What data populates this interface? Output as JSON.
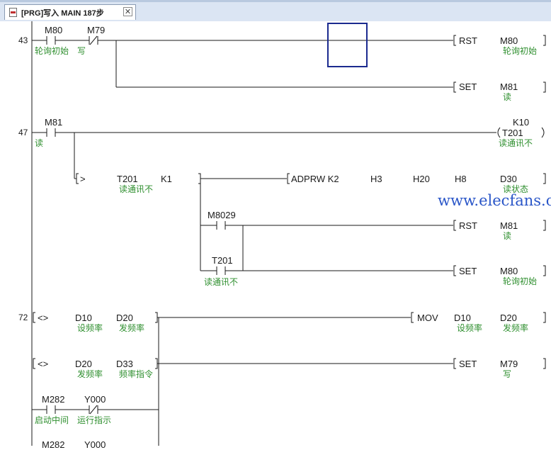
{
  "tab": {
    "title": "[PRG]写入 MAIN 187步",
    "close_glyph": "✕"
  },
  "watermark": "www.elecfans.com",
  "rungs": {
    "r43": {
      "step": "43",
      "contacts": [
        {
          "device": "M80",
          "comment": "轮询初始"
        },
        {
          "device": "M79",
          "comment": "写"
        }
      ],
      "out1": {
        "instr": "RST",
        "device": "M80",
        "comment": "轮询初始"
      },
      "out2": {
        "instr": "SET",
        "device": "M81",
        "comment": "读"
      }
    },
    "r47": {
      "step": "47",
      "contact": {
        "device": "M81",
        "comment": "读"
      },
      "timer": {
        "const": "K10",
        "device": "T201",
        "comment": "读通讯不"
      },
      "compare": {
        "op": ">",
        "device": "T201",
        "comment": "读通讯不",
        "value": "K1"
      },
      "adprw": {
        "instr": "ADPRW K2",
        "a1": "H3",
        "a2": "H20",
        "a3": "H8",
        "dev": "D30",
        "comment": "读状态"
      },
      "branch1": {
        "device": "M8029",
        "instr": "RST",
        "out": "M81",
        "out_comment": "读"
      },
      "branch2": {
        "device": "T201",
        "comment": "读通讯不",
        "instr": "SET",
        "out": "M80",
        "out_comment": "轮询初始"
      }
    },
    "r72": {
      "step": "72",
      "compare1": {
        "op": "<>",
        "a": "D10",
        "a_comment": "设频率",
        "b": "D20",
        "b_comment": "发频率"
      },
      "mov": {
        "instr": "MOV",
        "s": "D10",
        "s_comment": "设频率",
        "d": "D20",
        "d_comment": "发频率"
      },
      "compare2": {
        "op": "<>",
        "a": "D20",
        "a_comment": "发频率",
        "b": "D33",
        "b_comment": "频率指令"
      },
      "set": {
        "instr": "SET",
        "device": "M79",
        "comment": "写"
      },
      "row3": [
        {
          "device": "M282",
          "comment": "启动中间"
        },
        {
          "device": "Y000",
          "comment": "运行指示"
        }
      ],
      "row4": [
        {
          "device": "M282"
        },
        {
          "device": "Y000"
        }
      ]
    }
  }
}
